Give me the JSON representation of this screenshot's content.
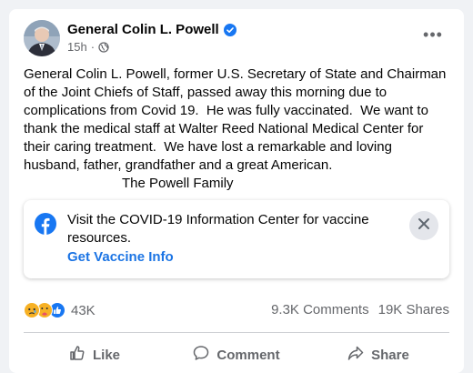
{
  "post": {
    "author": "General Colin L. Powell",
    "time": "15h",
    "separator": "·",
    "body": "General Colin L. Powell, former U.S. Secretary of State and Chairman of the Joint Chiefs of Staff, passed away this morning due to complications from Covid 19.  He was fully vaccinated.  We want to thank the medical staff at Walter Reed National Medical Center for their caring treatment.  We have lost a remarkable and loving husband, father, grandfather and a great American.",
    "signature": "The Powell Family"
  },
  "covid_banner": {
    "text": "Visit the COVID-19 Information Center for vaccine resources.",
    "link": "Get Vaccine Info"
  },
  "stats": {
    "reactions_count": "43K",
    "comments": "9.3K Comments",
    "shares": "19K Shares"
  },
  "actions": {
    "like": "Like",
    "comment": "Comment",
    "share": "Share"
  },
  "icons": {
    "verified": "verified-badge-icon",
    "privacy": "globe-icon",
    "more": "more-options-icon",
    "facebook": "facebook-logo-icon",
    "close": "close-icon",
    "reactions": [
      "sad-reaction-icon",
      "care-reaction-icon",
      "like-reaction-icon"
    ]
  },
  "colors": {
    "accent": "#1b74e4",
    "secondary_text": "#65676b"
  }
}
